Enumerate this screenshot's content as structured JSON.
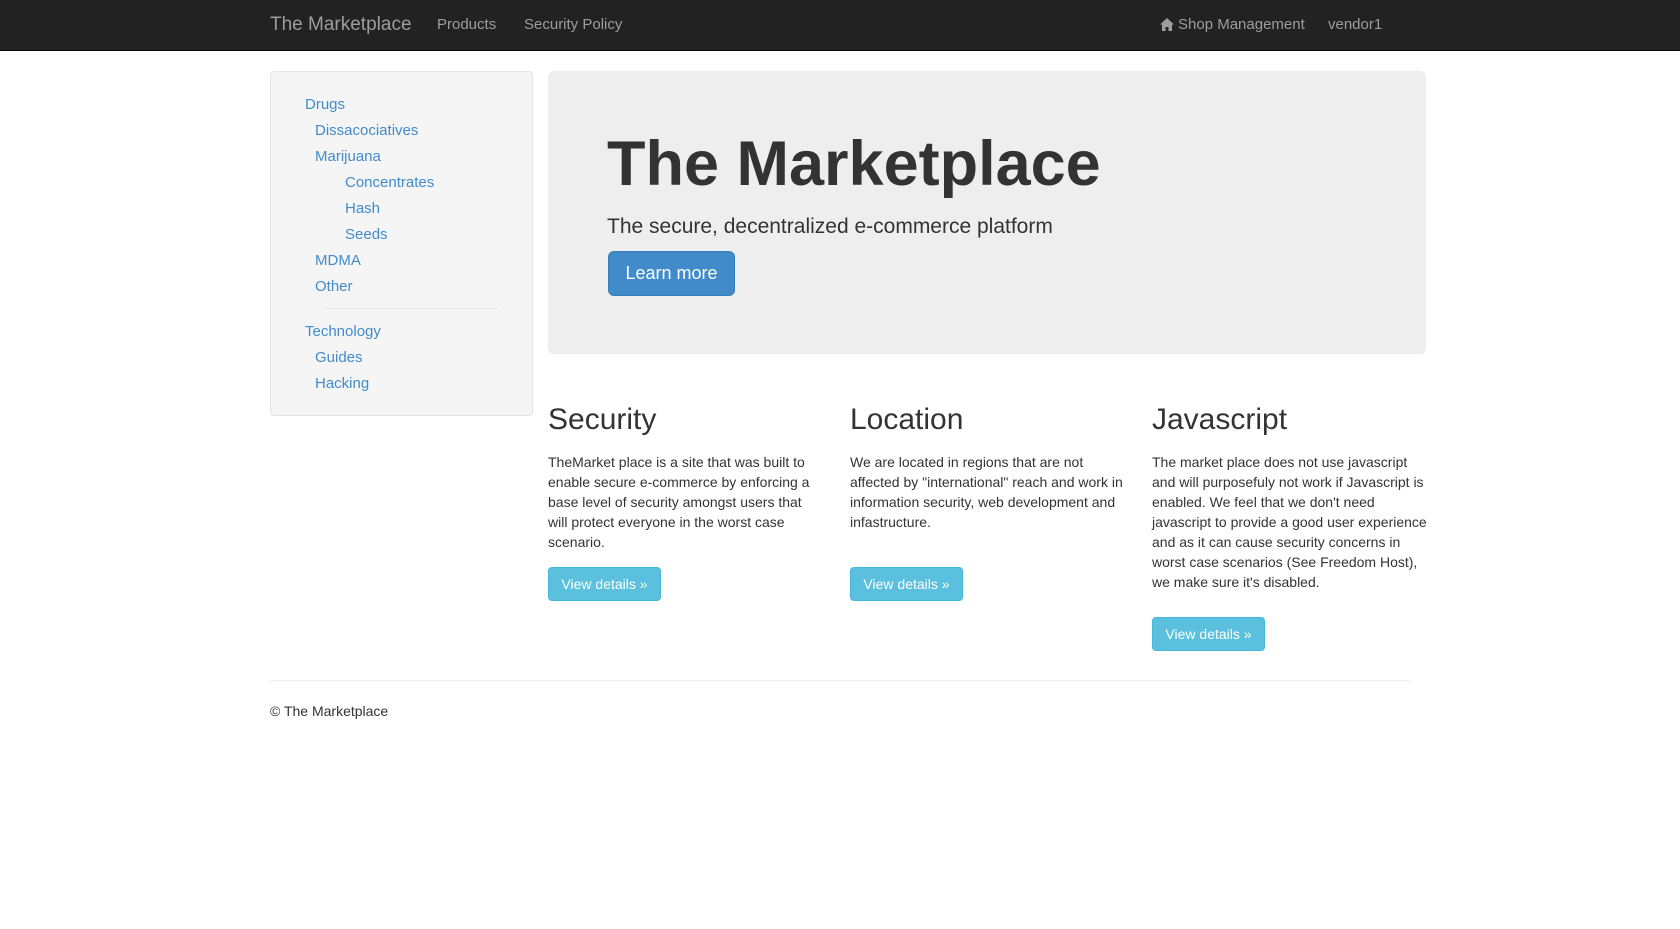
{
  "navbar": {
    "brand": "The Marketplace",
    "links": [
      "Products",
      "Security Policy"
    ],
    "shop_management": "Shop Management",
    "user": "vendor1",
    "home_icon": "home-icon"
  },
  "sidebar": {
    "groups": [
      {
        "label": "Drugs",
        "items": [
          {
            "label": "Dissacociatives",
            "children": []
          },
          {
            "label": "Marijuana",
            "children": [
              "Concentrates",
              "Hash",
              "Seeds"
            ]
          },
          {
            "label": "MDMA",
            "children": []
          },
          {
            "label": "Other",
            "children": []
          }
        ]
      },
      {
        "label": "Technology",
        "items": [
          {
            "label": "Guides",
            "children": []
          },
          {
            "label": "Hacking",
            "children": []
          }
        ]
      }
    ]
  },
  "jumbotron": {
    "title": "The Marketplace",
    "subtitle": "The secure, decentralized e-commerce platform",
    "button": "Learn more"
  },
  "columns": [
    {
      "heading": "Security",
      "text": "TheMarket place is a site that was built to enable secure e-commerce by enforcing a base level of security amongst users that will protect everyone in the worst case scenario.",
      "button": "View details »"
    },
    {
      "heading": "Location",
      "text": "We are located in regions that are not affected by \"international\" reach and work in information security, web development and infastructure.",
      "button": "View details »"
    },
    {
      "heading": "Javascript",
      "text": "The market place does not use javascript and will purposefuly not work if Javascript is enabled. We feel that we don't need javascript to provide a good user experience and as it can cause security concerns in worst case scenarios (See Freedom Host), we make sure it's disabled.",
      "button": "View details »"
    }
  ],
  "footer": {
    "text": "© The Marketplace"
  },
  "colors": {
    "navbar_bg": "#222222",
    "navbar_text": "#9d9d9d",
    "link": "#428bca",
    "primary": "#428bca",
    "info": "#5bc0de",
    "jumbotron_bg": "#eeeeee"
  }
}
